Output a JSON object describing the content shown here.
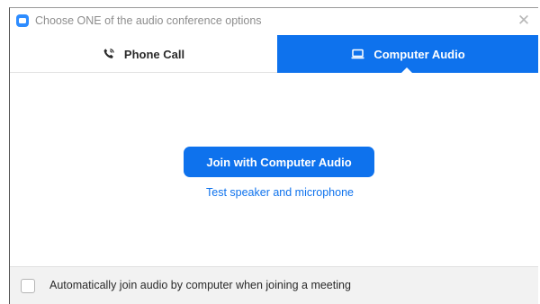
{
  "window": {
    "title": "Choose ONE of the audio conference options",
    "close_glyph": "✕"
  },
  "tabs": [
    {
      "label": "Phone Call",
      "icon": "phone-icon",
      "selected": false
    },
    {
      "label": "Computer Audio",
      "icon": "computer-icon",
      "selected": true
    }
  ],
  "main": {
    "join_button_label": "Join with Computer Audio",
    "test_link_label": "Test speaker and microphone"
  },
  "footer": {
    "auto_join_label": "Automatically join audio by computer when joining a meeting",
    "auto_join_checked": false
  },
  "colors": {
    "accent": "#0e72ed",
    "app_icon": "#2d8cff",
    "footer_bg": "#f2f2f2"
  }
}
